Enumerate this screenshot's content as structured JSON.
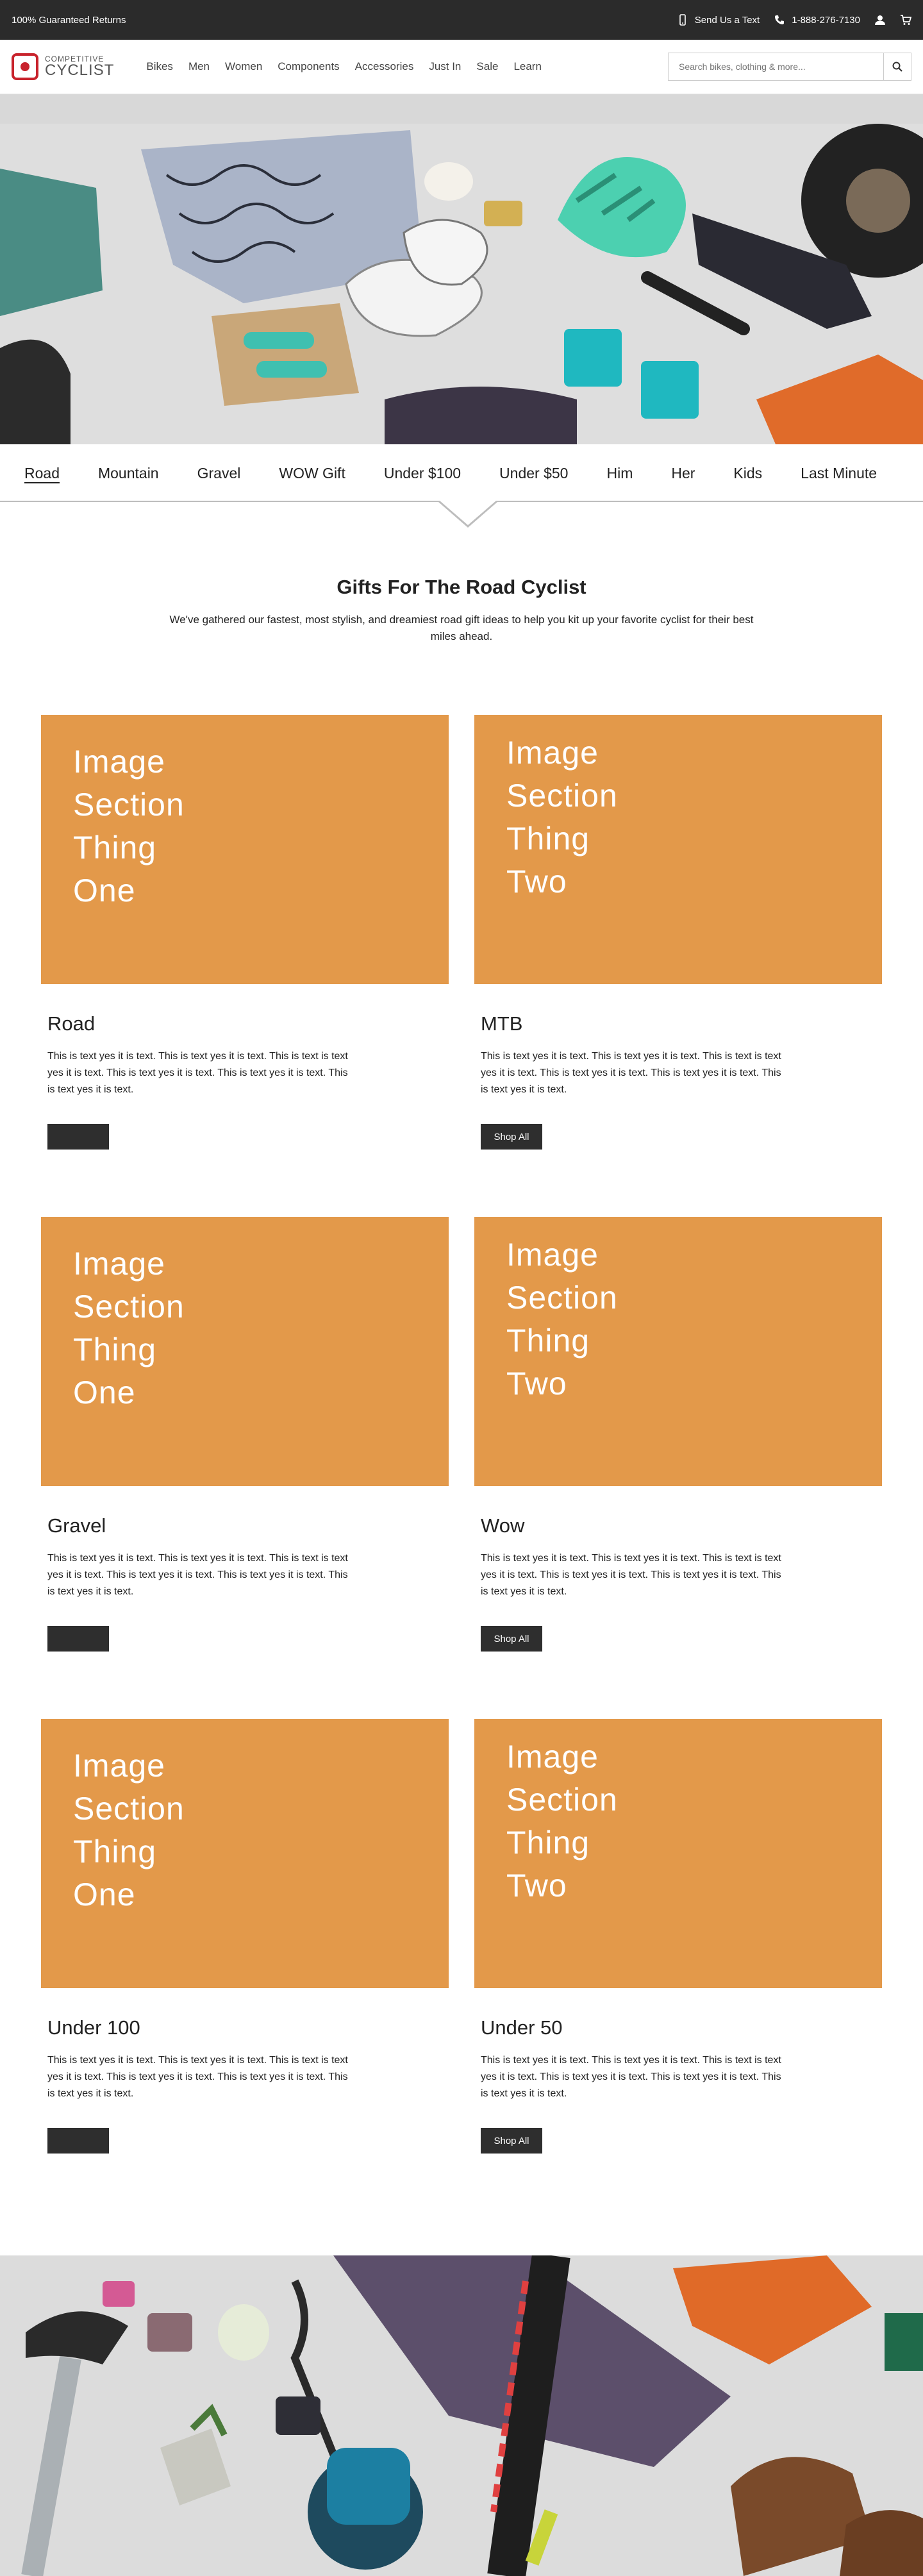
{
  "utility": {
    "returns": "100% Guaranteed Returns",
    "text_us": "Send Us a Text",
    "phone": "1-888-276-7130"
  },
  "header": {
    "logo_top": "COMPETITIVE",
    "logo_bottom": "CYCLIST",
    "nav": [
      "Bikes",
      "Men",
      "Women",
      "Components",
      "Accessories",
      "Just In",
      "Sale",
      "Learn"
    ],
    "search_placeholder": "Search bikes, clothing & more..."
  },
  "tabs": [
    "Road",
    "Mountain",
    "Gravel",
    "WOW Gift",
    "Under $100",
    "Under $50",
    "Him",
    "Her",
    "Kids",
    "Last Minute"
  ],
  "intro": {
    "title": "Gifts For The Road Cyclist",
    "text": "We've gathered our fastest, most stylish, and dreamiest road gift ideas to help you kit up your favorite cyclist for their best miles ahead."
  },
  "cards": [
    {
      "image_text": [
        "Image",
        "Section",
        "Thing",
        "One"
      ],
      "title": "Road",
      "text": "This is text yes it is text. This is text yes it is text. This is text is text yes it is text. This is text yes it is text. This is text yes it is text. This is text yes it is text.",
      "button": ""
    },
    {
      "image_text": [
        "Image",
        "Section",
        "Thing",
        "Two"
      ],
      "title": "MTB",
      "text": "This is text yes it is text. This is text yes it is text. This is text is text yes it is text. This is text yes it is text. This is text yes it is text. This is text yes it is text.",
      "button": "Shop All"
    },
    {
      "image_text": [
        "Image",
        "Section",
        "Thing",
        "One"
      ],
      "title": "Gravel",
      "text": "This is text yes it is text. This is text yes it is text. This is text is text yes it is text. This is text yes it is text. This is text yes it is text. This is text yes it is text.",
      "button": ""
    },
    {
      "image_text": [
        "Image",
        "Section",
        "Thing",
        "Two"
      ],
      "title": "Wow",
      "text": "This is text yes it is text. This is text yes it is text. This is text is text yes it is text. This is text yes it is text. This is text yes it is text. This is text yes it is text.",
      "button": "Shop All"
    },
    {
      "image_text": [
        "Image",
        "Section",
        "Thing",
        "One"
      ],
      "title": "Under 100",
      "text": "This is text yes it is text. This is text yes it is text. This is text is text yes it is text. This is text yes it is text. This is text yes it is text. This is text yes it is text.",
      "button": ""
    },
    {
      "image_text": [
        "Image",
        "Section",
        "Thing",
        "Two"
      ],
      "title": "Under 50",
      "text": "This is text yes it is text. This is text yes it is text. This is text is text yes it is text. This is text yes it is text. This is text yes it is text. This is text yes it is text.",
      "button": "Shop All"
    }
  ],
  "colors": {
    "utility_bg": "#2b2b2b",
    "brand_red": "#c8232c",
    "card_orange": "#e3994a",
    "button_dark": "#2e2e2e"
  },
  "icons": [
    "phone-icon",
    "user-icon",
    "cart-icon",
    "search-icon",
    "mobile-icon"
  ]
}
